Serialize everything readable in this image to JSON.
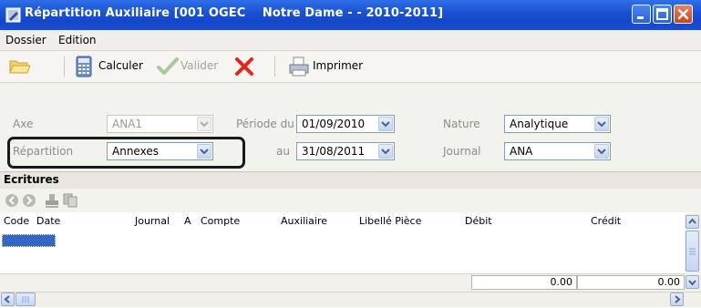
{
  "window": {
    "title": "Répartition Auxiliaire [001 OGEC    Notre Dame - - 2010-2011]"
  },
  "menu": [
    "Dossier",
    "Edition"
  ],
  "toolbar": {
    "calculer": "Calculer",
    "valider": "Valider",
    "imprimer": "Imprimer"
  },
  "form": {
    "axe_label": "Axe",
    "axe_value": "ANA1",
    "repartition_label": "Répartition",
    "repartition_value": "Annexes",
    "periode_du_label": "Période du",
    "periode_du_value": "01/09/2010",
    "au_label": "au",
    "au_value": "31/08/2011",
    "nature_label": "Nature",
    "nature_value": "Analytique",
    "journal_label": "Journal",
    "journal_value": "ANA"
  },
  "ecritures": {
    "title": "Ecritures",
    "columns": [
      "Code",
      "Date",
      "Journal",
      "A",
      "Compte",
      "Auxiliaire",
      "Libellé Pièce",
      "Débit",
      "Crédit"
    ],
    "total_debit": "0.00",
    "total_credit": "0.00"
  },
  "colors": {
    "titlebar": "#1b53d4",
    "close_button": "#c9451e",
    "selection": "#3468c4",
    "cancel_red": "#e1261c"
  }
}
